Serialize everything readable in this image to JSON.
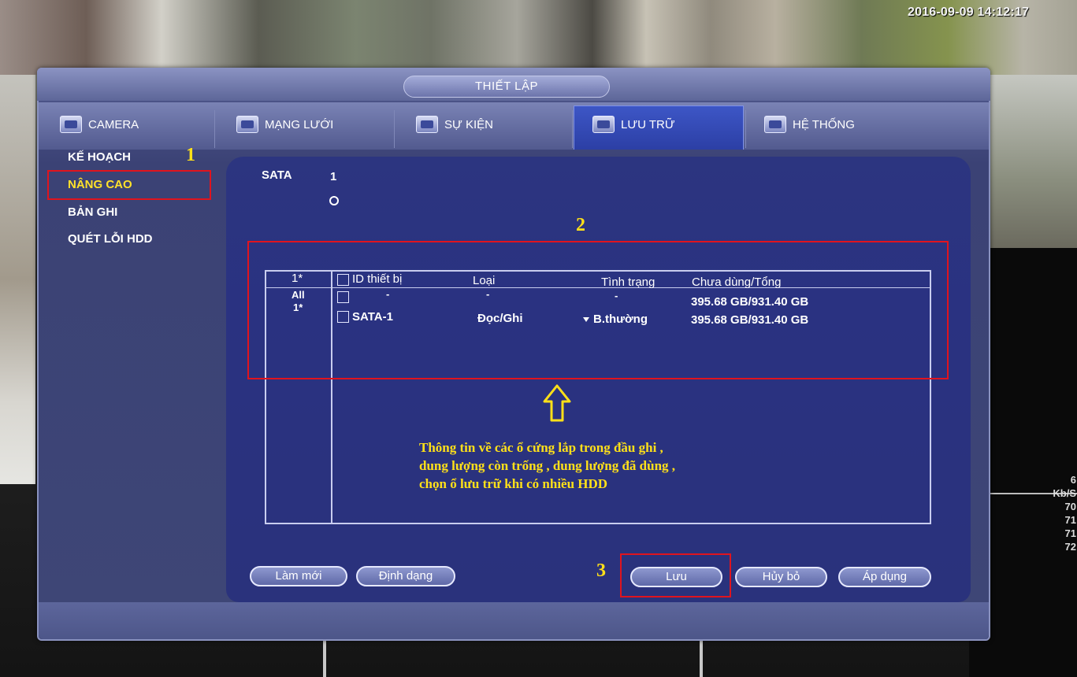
{
  "overlay": {
    "timestamp": "2016-09-09 14:12:17",
    "side_stats": [
      "6",
      "Kb/S",
      "70",
      "71",
      "71",
      "72"
    ]
  },
  "dialog": {
    "title": "THIẾT LẬP"
  },
  "tabs": [
    {
      "label": "CAMERA",
      "icon": "camera-icon"
    },
    {
      "label": "MẠNG LƯỚI",
      "icon": "network-icon"
    },
    {
      "label": "SỰ KIỆN",
      "icon": "event-icon"
    },
    {
      "label": "LƯU TRỮ",
      "icon": "storage-icon",
      "active": true
    },
    {
      "label": "HỆ THỐNG",
      "icon": "system-icon"
    }
  ],
  "menu": [
    {
      "label": "KẾ HOẠCH"
    },
    {
      "label": "NÂNG CAO",
      "active": true
    },
    {
      "label": "BẢN GHI"
    },
    {
      "label": "QUÉT LỖI HDD"
    }
  ],
  "sata": {
    "label": "SATA",
    "number": "1"
  },
  "table": {
    "headers": {
      "index": "1*",
      "device_id": "ID thiết bị",
      "type": "Loại",
      "status": "Tình trạng",
      "capacity": "Chưa dùng/Tổng"
    },
    "rows": [
      {
        "index": "All",
        "device_id": "-",
        "type": "-",
        "status": "-",
        "capacity": "395.68 GB/931.40 GB"
      },
      {
        "index": "1*",
        "device_id": "SATA-1",
        "type": "Đọc/Ghi",
        "status": "B.thường",
        "capacity": "395.68 GB/931.40 GB"
      }
    ]
  },
  "annotations": {
    "step1": "1",
    "step2": "2",
    "step3": "3",
    "note_lines": [
      "Thông tin về các ổ cứng lắp trong đầu ghi ,",
      "dung lượng còn trống , dung lượng đã dùng ,",
      "chọn ổ lưu trữ khi có nhiều HDD"
    ],
    "color": "#ffe019",
    "highlight_color": "#e0141e"
  },
  "buttons": {
    "refresh": "Làm mới",
    "format": "Định dạng",
    "save": "Lưu",
    "cancel": "Hủy bỏ",
    "apply": "Áp dụng"
  }
}
